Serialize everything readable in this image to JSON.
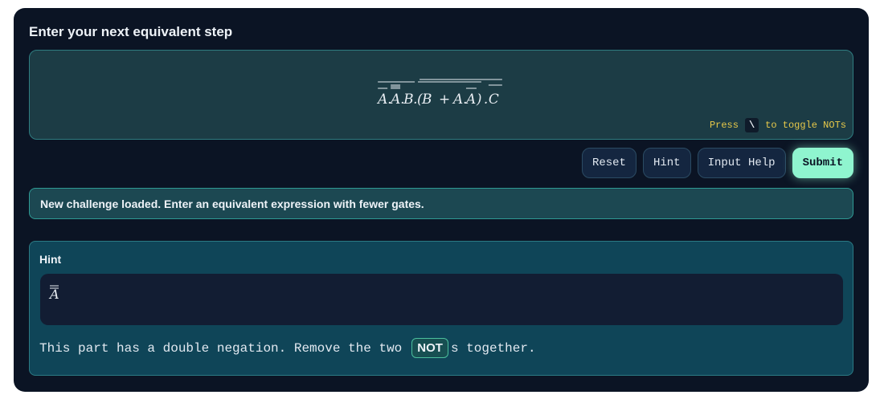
{
  "header": {
    "title": "Enter your next equivalent step"
  },
  "editor": {
    "expression": {
      "segments": [
        "A",
        ".",
        "A",
        ".",
        "B",
        ".",
        "(",
        "B",
        "+",
        "A",
        ".",
        "A",
        ")",
        ".",
        "C"
      ]
    },
    "toggle_hint": {
      "prefix": "Press",
      "key": "\\",
      "suffix": "to toggle NOTs"
    }
  },
  "actions": {
    "reset_label": "Reset",
    "hint_label": "Hint",
    "input_help_label": "Input Help",
    "submit_label": "Submit"
  },
  "status": {
    "message": "New challenge loaded. Enter an equivalent expression with fewer gates."
  },
  "hint": {
    "title": "Hint",
    "expression": "A",
    "text_before": "This part has a double negation. Remove the two",
    "chip": "NOT",
    "text_after": "s together."
  },
  "colors": {
    "panel_bg": "#0b1424",
    "accent": "#8ff5cf",
    "highlight_text": "#e7c94a"
  }
}
